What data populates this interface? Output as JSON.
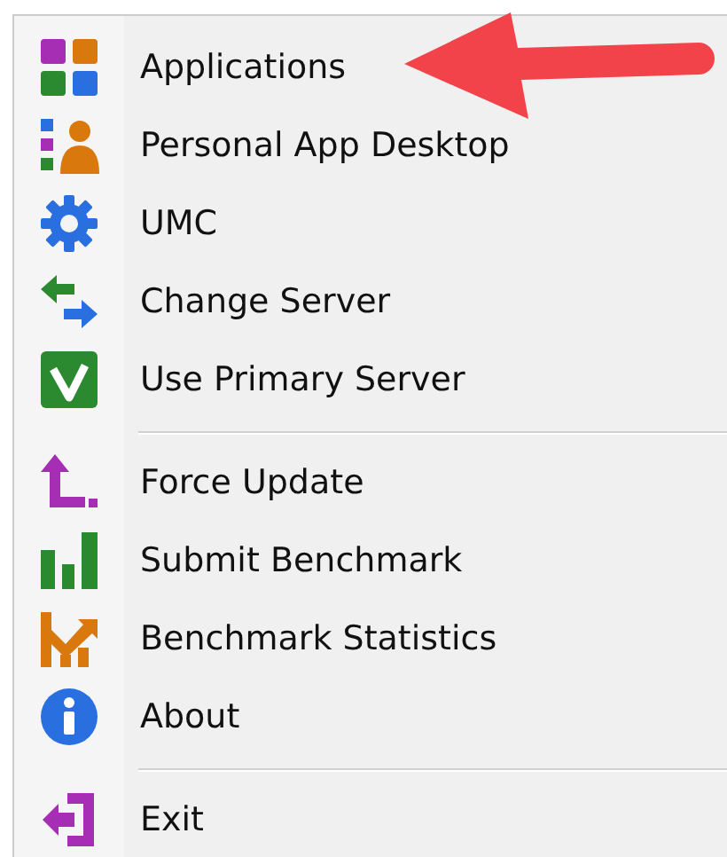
{
  "menu": {
    "items": [
      {
        "kind": "item",
        "label": "Applications"
      },
      {
        "kind": "item",
        "label": "Personal App Desktop"
      },
      {
        "kind": "item",
        "label": "UMC"
      },
      {
        "kind": "item",
        "label": "Change Server"
      },
      {
        "kind": "item",
        "label": "Use Primary Server"
      },
      {
        "kind": "separator"
      },
      {
        "kind": "item",
        "label": "Force Update"
      },
      {
        "kind": "item",
        "label": "Submit Benchmark"
      },
      {
        "kind": "item",
        "label": "Benchmark Statistics"
      },
      {
        "kind": "item",
        "label": "About"
      },
      {
        "kind": "separator"
      },
      {
        "kind": "item",
        "label": "Exit"
      }
    ]
  }
}
